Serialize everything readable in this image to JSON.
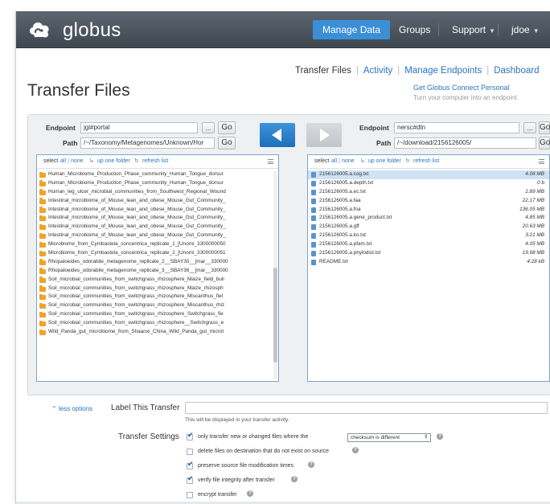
{
  "topbar": {
    "logo_text": "globus",
    "nav": [
      {
        "label": "Manage Data"
      },
      {
        "label": "Groups"
      },
      {
        "label": "Support"
      },
      {
        "label": "jdoe"
      }
    ]
  },
  "subnav": {
    "items": [
      {
        "label": "Transfer Files"
      },
      {
        "label": "Activity"
      },
      {
        "label": "Manage Endpoints"
      },
      {
        "label": "Dashboard"
      }
    ]
  },
  "page": {
    "title": "Transfer Files",
    "gcp_link": "Get Globus Connect Personal",
    "gcp_sub": "Turn your computer into an endpoint."
  },
  "left": {
    "endpoint_label": "Endpoint",
    "endpoint_value": "jgi#portal",
    "path_label": "Path",
    "path_value": "/~/Taxonomy/Metagenomes/Unknown/Hor",
    "browse_label": "...",
    "go_label": "Go",
    "toolbar": {
      "select": "select",
      "all": "all",
      "none": "none",
      "up": "up one folder",
      "refresh": "refresh list"
    },
    "files": [
      "Human_Microbiome_Production_Phase_community_Human_Tongue_dorsur",
      "Human_Microbiome_Production_Phase_community_Human_Tongue_dorsur",
      "Human_leg_ulcer_microbial_communities_from_Southwest_Regional_Wound",
      "Intestinal_microbiome_of_Mouse_lean_and_obese_Mouse_Gut_Community_",
      "Intestinal_microbiome_of_Mouse_lean_and_obese_Mouse_Gut_Community_",
      "Intestinal_microbiome_of_Mouse_lean_and_obese_Mouse_Gut_Community_",
      "Intestinal_microbiome_of_Mouse_lean_and_obese_Mouse_Gut_Community_",
      "Intestinal_microbiome_of_Mouse_lean_and_obese_Mouse_Gut_Community_",
      "Microbiome_from_Cymbastela_concentrica_replicate_1_[Unomi_3300000050",
      "Microbiome_from_Cymbastela_concentrica_replicate_2_[Unomi_3300000051",
      "Rhopaloeides_odorabile_metagenome_replicate_2__SBAY35__[mar__330000",
      "Rhopaloeides_odorabile_metagenome_replicate_3__SBAY36__[mar__330000",
      "Soil_microbial_communities_from_switchgrass_rhizosphere_Maize_field_buli",
      "Soil_microbial_communities_from_switchgrass_rhizosphere_Maize_rhizosph",
      "Soil_microbial_communities_from_switchgrass_rhizosphere_Miscanthus_fiel",
      "Soil_microbial_communities_from_switchgrass_rhizosphere_Miscanthus_rhiz",
      "Soil_microbial_communities_from_switchgrass_rhizosphere_Switchgrass_fie",
      "Soil_microbial_communities_from_switchgrass_rhizosphere__Switchgrass_e",
      "Wild_Panda_gut_microbiome_from_Shaanxi_China_Wild_Panda_gut_microt"
    ]
  },
  "right": {
    "endpoint_label": "Endpoint",
    "endpoint_value": "nersc#dtn",
    "path_label": "Path",
    "path_value": "/~/download/2156126005/",
    "browse_label": "...",
    "go_label": "Go",
    "toolbar": {
      "select": "select",
      "all": "all",
      "none": "none",
      "up": "up one folder",
      "refresh": "refresh list"
    },
    "files": [
      {
        "name": "2156126005.a.cog.txt",
        "size": "4.06 MB"
      },
      {
        "name": "2156126005.a.depth.txt",
        "size": "0 b"
      },
      {
        "name": "2156126005.a.ec.txt",
        "size": "1.89 MB"
      },
      {
        "name": "2156126005.a.faa",
        "size": "22.17 MB"
      },
      {
        "name": "2156126005.a.fna",
        "size": "136.05 MB"
      },
      {
        "name": "2156126005.a.gene_product.txt",
        "size": "4.85 MB"
      },
      {
        "name": "2156126005.a.gff",
        "size": "20.63 MB"
      },
      {
        "name": "2156126005.a.ko.txt",
        "size": "3.21 MB"
      },
      {
        "name": "2156126005.a.pfam.txt",
        "size": "4.05 MB"
      },
      {
        "name": "2156126005.a.phylodist.txt",
        "size": "19.98 MB"
      },
      {
        "name": "README.txt",
        "size": "4.28 kB"
      }
    ]
  },
  "options": {
    "less_options": "less options",
    "label_title": "Label This Transfer",
    "label_hint": "This will be displayed in your transfer activity.",
    "settings_title": "Transfer Settings",
    "sync_option": "only transfer new or changed files where the",
    "sync_select": "checksum is different",
    "delete_option": "delete files on destination that do not exist on source",
    "preserve_option": "preserve source file modification times",
    "verify_option": "verify file integrity after transfer",
    "encrypt_option": "encrypt transfer"
  }
}
